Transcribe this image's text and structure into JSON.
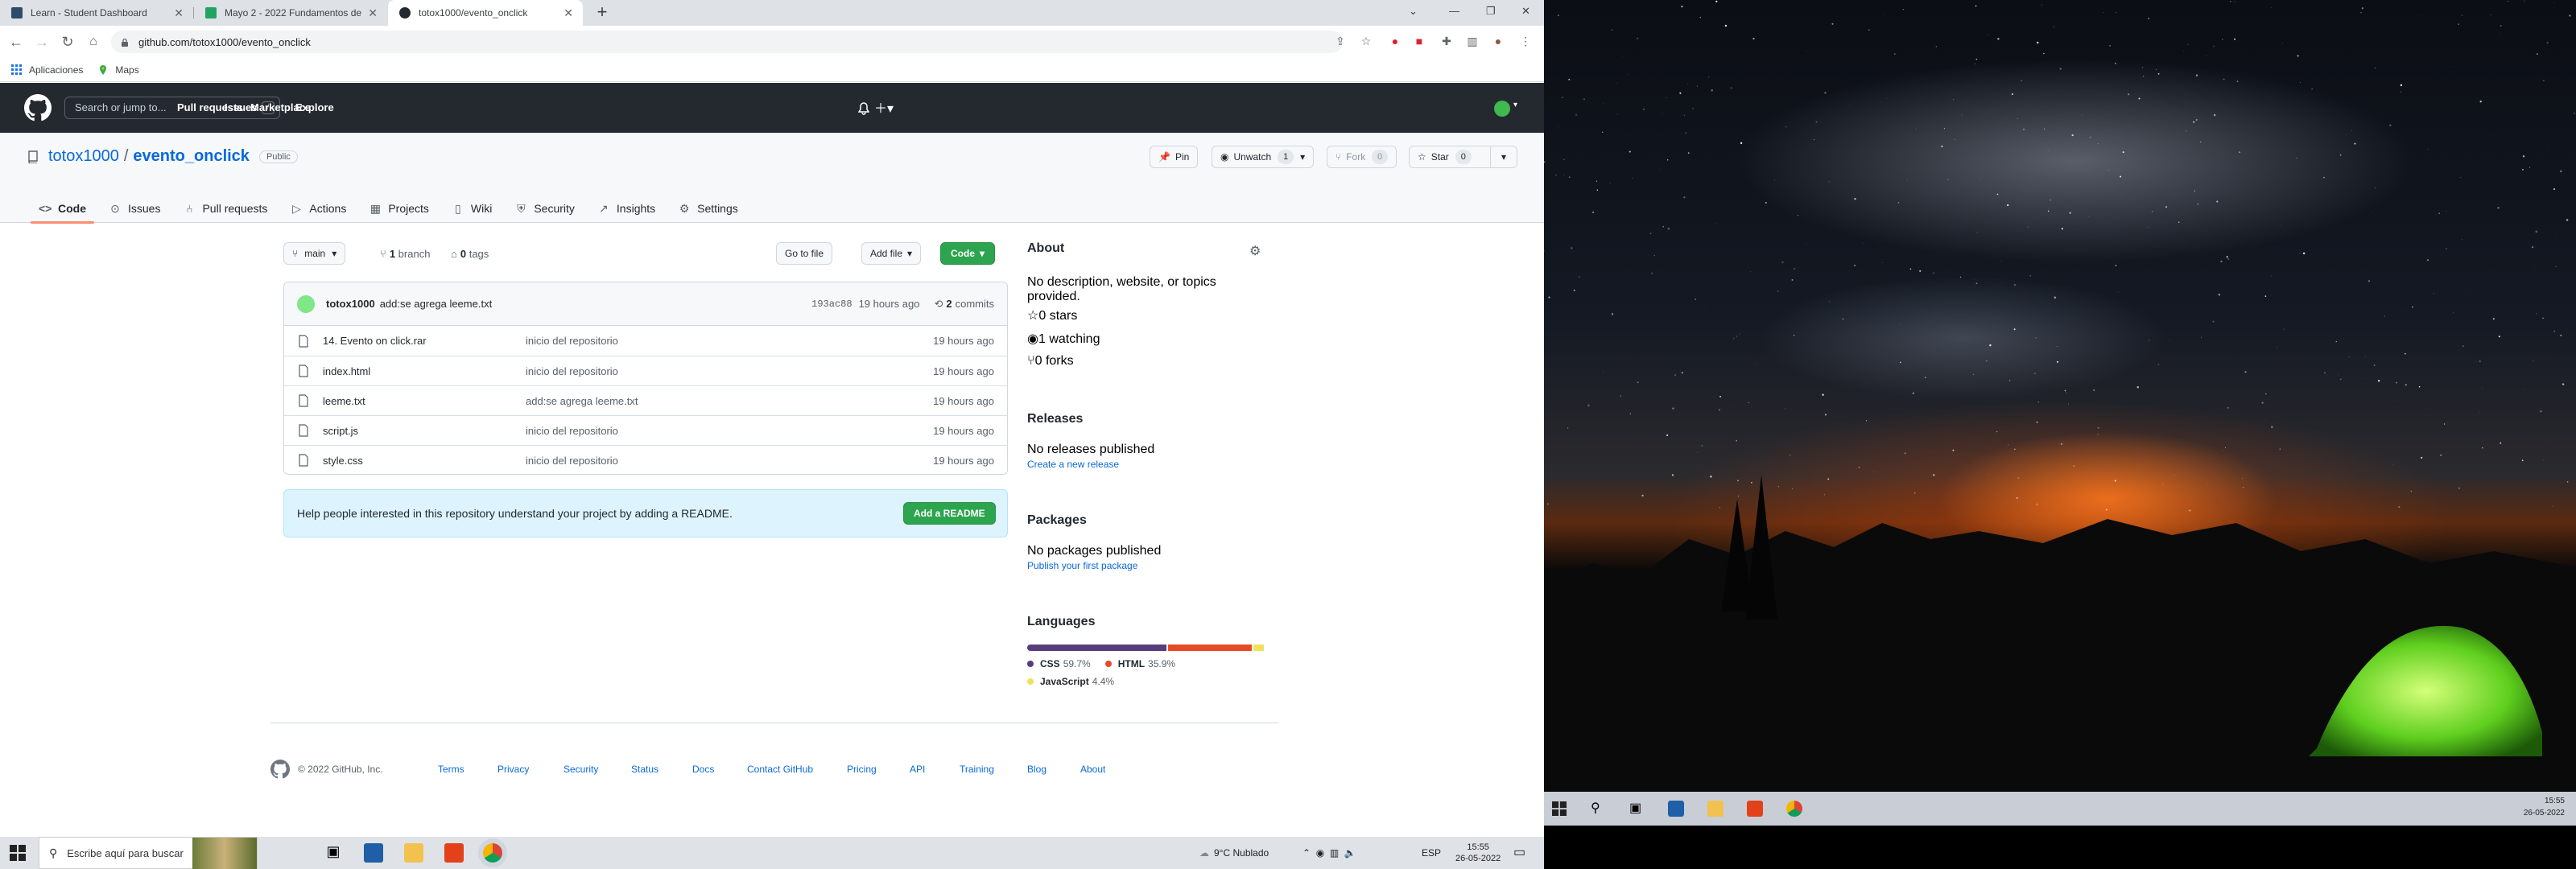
{
  "browser": {
    "tabs": [
      {
        "title": "Learn - Student Dashboard",
        "favicon_color": "#2d4b6b"
      },
      {
        "title": "Mayo 2 - 2022 Fundamentos de",
        "favicon_color": "#1fa463"
      },
      {
        "title": "totox1000/evento_onclick",
        "favicon_color": "#24292f"
      }
    ],
    "address": "github.com/totox1000/evento_onclick",
    "bookmarks": [
      {
        "label": "Aplicaciones"
      },
      {
        "label": "Maps"
      }
    ]
  },
  "gh": {
    "search_placeholder": "Search or jump to...",
    "slash_key": "/",
    "nav": [
      "Pull requests",
      "Issues",
      "Marketplace",
      "Explore"
    ]
  },
  "repo": {
    "owner": "totox1000",
    "slash": "/",
    "name": "evento_onclick",
    "visibility": "Public",
    "pin_label": "Pin",
    "unwatch_label": "Unwatch",
    "unwatch_count": "1",
    "fork_label": "Fork",
    "fork_count": "0",
    "star_label": "Star",
    "star_count": "0",
    "tabs": [
      "Code",
      "Issues",
      "Pull requests",
      "Actions",
      "Projects",
      "Wiki",
      "Security",
      "Insights",
      "Settings"
    ]
  },
  "code": {
    "branch": "main",
    "branches_count": "1",
    "branches_label": "branch",
    "tags_count": "0",
    "tags_label": "tags",
    "go_to_file": "Go to file",
    "add_file": "Add file",
    "code_btn": "Code",
    "commit": {
      "author": "totox1000",
      "message": "add:se agrega leeme.txt",
      "hash": "193ac88",
      "age": "19 hours ago",
      "count": "2",
      "count_label": "commits"
    },
    "files": [
      {
        "name": "14. Evento on click.rar",
        "message": "inicio del repositorio",
        "age": "19 hours ago"
      },
      {
        "name": "index.html",
        "message": "inicio del repositorio",
        "age": "19 hours ago"
      },
      {
        "name": "leeme.txt",
        "message": "add:se agrega leeme.txt",
        "age": "19 hours ago"
      },
      {
        "name": "script.js",
        "message": "inicio del repositorio",
        "age": "19 hours ago"
      },
      {
        "name": "style.css",
        "message": "inicio del repositorio",
        "age": "19 hours ago"
      }
    ],
    "readme_text": "Help people interested in this repository understand your project by adding a README.",
    "readme_button": "Add a README"
  },
  "about": {
    "title": "About",
    "description": "No description, website, or topics provided.",
    "stars": "0 stars",
    "watching": "1 watching",
    "forks": "0 forks",
    "releases_title": "Releases",
    "releases_text": "No releases published",
    "releases_link": "Create a new release",
    "packages_title": "Packages",
    "packages_text": "No packages published",
    "packages_link": "Publish your first package",
    "languages_title": "Languages",
    "languages": [
      {
        "name": "CSS",
        "pct": "59.7%",
        "value": 59.7,
        "color": "#563d7c"
      },
      {
        "name": "HTML",
        "pct": "35.9%",
        "value": 35.9,
        "color": "#e34c26"
      },
      {
        "name": "JavaScript",
        "pct": "4.4%",
        "value": 4.4,
        "color": "#f1e05a"
      }
    ]
  },
  "footer": {
    "copyright": "© 2022 GitHub, Inc.",
    "links": [
      "Terms",
      "Privacy",
      "Security",
      "Status",
      "Docs",
      "Contact GitHub",
      "Pricing",
      "API",
      "Training",
      "Blog",
      "About"
    ]
  },
  "taskbar": {
    "search": "Escribe aquí para buscar",
    "weather": "9°C  Nublado",
    "lang": "ESP",
    "time": "15:55",
    "date": "26-05-2022"
  },
  "right_taskbar": {
    "time": "15:55",
    "date": "26-05-2022"
  }
}
